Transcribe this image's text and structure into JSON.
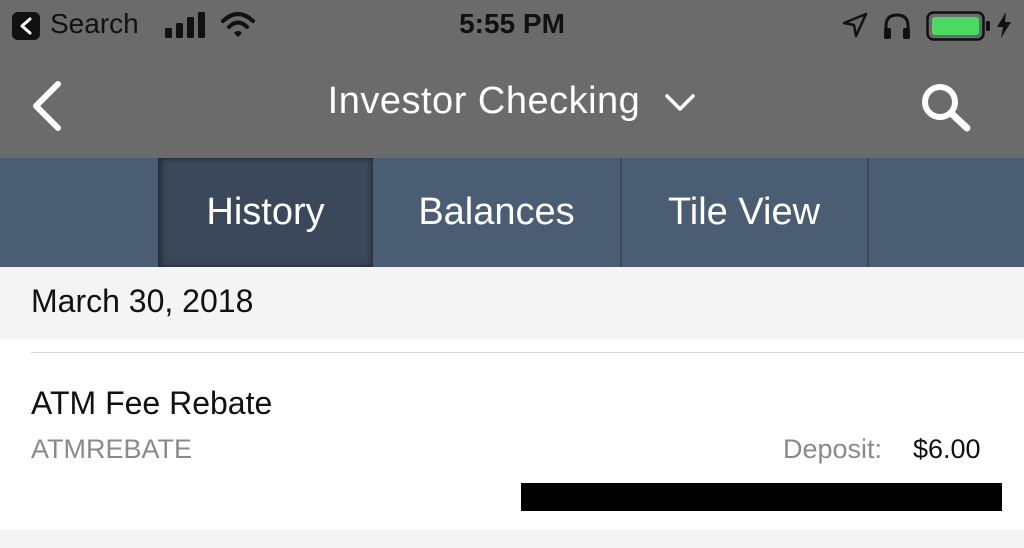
{
  "status_bar": {
    "back_label": "Search",
    "time": "5:55 PM",
    "battery_color": "#4cd964"
  },
  "nav": {
    "title": "Investor Checking"
  },
  "tabs": [
    {
      "label": "History",
      "active": true
    },
    {
      "label": "Balances",
      "active": false
    },
    {
      "label": "Tile View",
      "active": false
    }
  ],
  "colors": {
    "nav_bg": "#6b6b6b",
    "tab_bg": "#4b5d72",
    "tab_active_bg": "#3a4859"
  },
  "history": {
    "date": "March 30, 2018",
    "transactions": [
      {
        "title": "ATM Fee Rebate",
        "code": "ATMREBATE",
        "deposit_label": "Deposit:",
        "deposit_amount": "$6.00"
      }
    ]
  }
}
